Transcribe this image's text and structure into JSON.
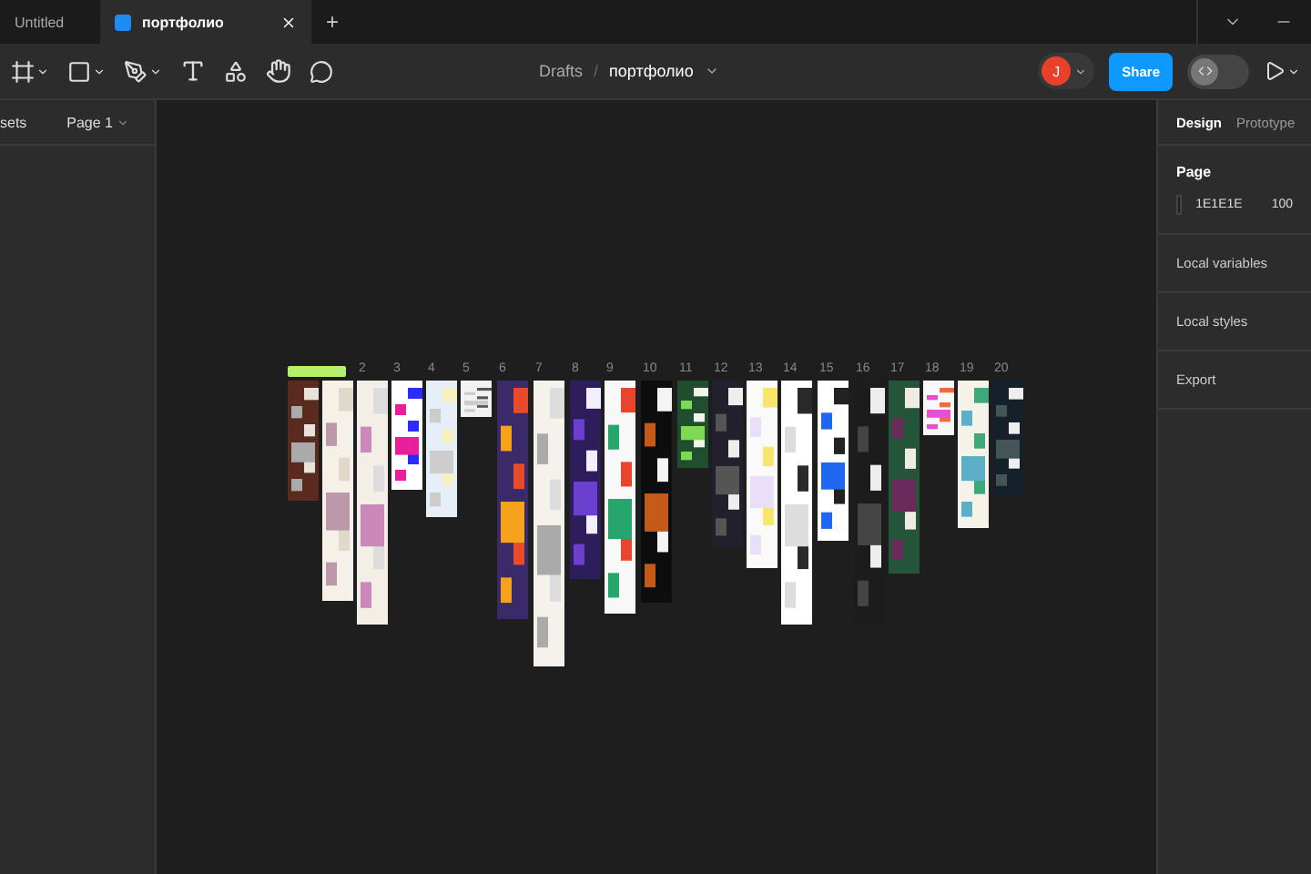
{
  "tabs": [
    {
      "label": "Untitled",
      "selected": false
    },
    {
      "label": "портфолио",
      "selected": true
    }
  ],
  "new_tab": "+",
  "toolbar": {
    "breadcrumb": {
      "folder": "Drafts",
      "separator": "/",
      "file": "портфолио"
    },
    "avatar": "J",
    "share": "Share",
    "dev_mode": {
      "on": false
    }
  },
  "left_panel": {
    "tab": "sets",
    "page": "Page 1"
  },
  "right_panel": {
    "tabs": [
      {
        "label": "Design",
        "selected": true
      },
      {
        "label": "Prototype",
        "selected": false
      }
    ],
    "page": {
      "heading": "Page",
      "color": "1E1E1E",
      "opacity": "100"
    },
    "sections": [
      "Local variables",
      "Local styles",
      "Export"
    ]
  },
  "canvas": {
    "frames": [
      {
        "sticker": true,
        "kind": "picture"
      },
      {
        "kind": "picture"
      },
      {
        "label": "2",
        "kind": "picture"
      },
      {
        "label": "3",
        "kind": "picture"
      },
      {
        "label": "4",
        "kind": "picture"
      },
      {
        "label": "5",
        "kind": "picture"
      },
      {
        "label": "6",
        "kind": "picture"
      },
      {
        "label": "7",
        "kind": "picture"
      },
      {
        "label": "8",
        "kind": "picture"
      },
      {
        "label": "9",
        "kind": "picture"
      },
      {
        "label": "10",
        "kind": "picture"
      },
      {
        "label": "11",
        "kind": "picture"
      },
      {
        "label": "12",
        "kind": "picture"
      },
      {
        "label": "13",
        "kind": "picture"
      },
      {
        "label": "14",
        "kind": "picture"
      },
      {
        "label": "15",
        "kind": "picture"
      },
      {
        "label": "16",
        "kind": "picture"
      },
      {
        "label": "17",
        "kind": "picture"
      },
      {
        "label": "18",
        "kind": "picture"
      },
      {
        "label": "19",
        "kind": "picture"
      },
      {
        "label": "20",
        "kind": "picture"
      }
    ]
  }
}
